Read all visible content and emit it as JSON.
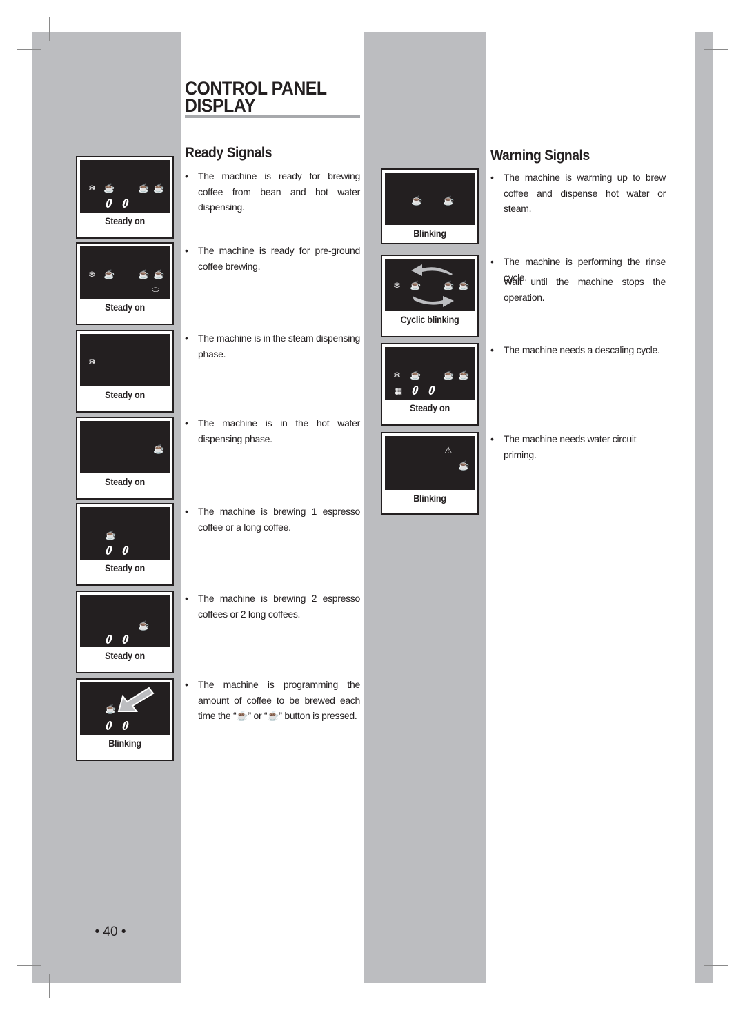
{
  "title": {
    "line1": "CONTROL PANEL",
    "line2": "DISPLAY"
  },
  "ready": {
    "heading": "Ready Signals",
    "items": [
      {
        "text": "The machine is ready for brewing coffee from bean and hot water dispensing.",
        "state": "Steady on",
        "icons": [
          "steam-icon",
          "espresso-cup-icon",
          "double-cup-icon",
          "hot-water-icon",
          "bean-icon",
          "bean-icon"
        ]
      },
      {
        "text": "The machine is ready for pre-ground coffee brewing.",
        "state": "Steady on",
        "icons": [
          "steam-icon",
          "espresso-cup-icon",
          "double-cup-icon",
          "hot-water-icon",
          "scoop-icon"
        ]
      },
      {
        "text": "The machine is in the steam dispensing phase.",
        "state": "Steady on",
        "icons": [
          "steam-icon"
        ]
      },
      {
        "text": "The machine is in the hot water dispensing phase.",
        "state": "Steady on",
        "icons": [
          "hot-water-icon"
        ]
      },
      {
        "text": "The machine is brewing 1 espresso coffee or a long coffee.",
        "state": "Steady on",
        "icons": [
          "espresso-cup-icon",
          "bean-icon",
          "bean-icon"
        ]
      },
      {
        "text": "The machine is brewing 2 espresso coffees or 2 long coffees.",
        "state": "Steady on",
        "icons": [
          "double-cup-icon",
          "bean-icon",
          "bean-icon"
        ]
      },
      {
        "text_part1": "The machine is programming the amount of coffee to be brewed each time the “",
        "text_part2": "” or “",
        "text_part3": "” button is pressed.",
        "state": "Blinking",
        "icons": [
          "espresso-cup-icon",
          "arrow-icon",
          "bean-icon",
          "bean-icon"
        ]
      }
    ]
  },
  "warning": {
    "heading": "Warning Signals",
    "items": [
      {
        "text": "The machine is warming up to brew coffee and dispense hot water or steam.",
        "state": "Blinking"
      },
      {
        "text": "The machine is performing the rinse cycle.",
        "text2": "Wait until the machine stops the operation.",
        "state": "Cyclic blinking"
      },
      {
        "text": "The machine needs a descaling cycle.",
        "state": "Steady on"
      },
      {
        "text": "The machine needs water circuit priming.",
        "state": "Blinking"
      }
    ]
  },
  "page_number": "• 40 •",
  "bullet": "•",
  "glyphs": {
    "steam": "❄",
    "cup": "☕",
    "warning": "⚠",
    "scoop": "⬭",
    "descale": "▦"
  }
}
